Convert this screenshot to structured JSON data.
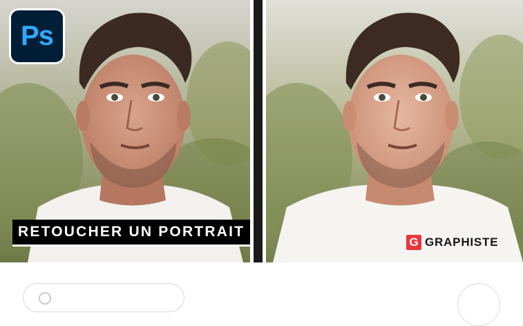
{
  "app_icon": {
    "name": "photoshop-icon",
    "label": "Ps",
    "color": "#31a8ff",
    "bg": "#001e36"
  },
  "before_panel": {
    "caption": "RETOUCHER UN PORTRAIT"
  },
  "after_panel": {
    "brand_icon_letter": "G",
    "brand_name": "GRAPHISTE",
    "brand_color": "#e8373d"
  },
  "bottom_bar": {
    "field_icon": "circle-icon",
    "button_icon": "circle-button-icon"
  }
}
